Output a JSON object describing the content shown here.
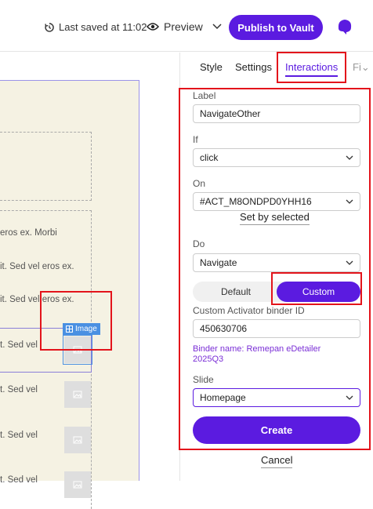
{
  "topbar": {
    "saved_label": "Last saved at 11:02",
    "preview_label": "Preview",
    "publish_label": "Publish to Vault"
  },
  "canvas": {
    "lines": [
      "eros ex. Morbi",
      "it. Sed vel eros ex.",
      "it. Sed vel eros ex.",
      "t. Sed vel",
      "t. Sed vel",
      "t. Sed vel",
      "t. Sed vel"
    ],
    "image_tag": "Image"
  },
  "panel": {
    "tabs": [
      "Style",
      "Settings",
      "Interactions",
      "Fi"
    ],
    "label": {
      "title": "Label",
      "value": "NavigateOther"
    },
    "if": {
      "title": "If",
      "value": "click"
    },
    "on": {
      "title": "On",
      "value": "#ACT_M8ONDPD0YHH16",
      "set_by": "Set by selected"
    },
    "do": {
      "title": "Do",
      "value": "Navigate"
    },
    "mode": {
      "default": "Default",
      "custom": "Custom"
    },
    "binder": {
      "title": "Custom Activator binder ID",
      "value": "450630706",
      "name": "Binder name: Remepan eDetailer 2025Q3"
    },
    "slide": {
      "title": "Slide",
      "value": "Homepage"
    },
    "create_label": "Create",
    "cancel_label": "Cancel"
  },
  "colors": {
    "accent": "#5b1be0",
    "highlight": "#e3141b",
    "canvas_bg": "#f5f2e3"
  }
}
